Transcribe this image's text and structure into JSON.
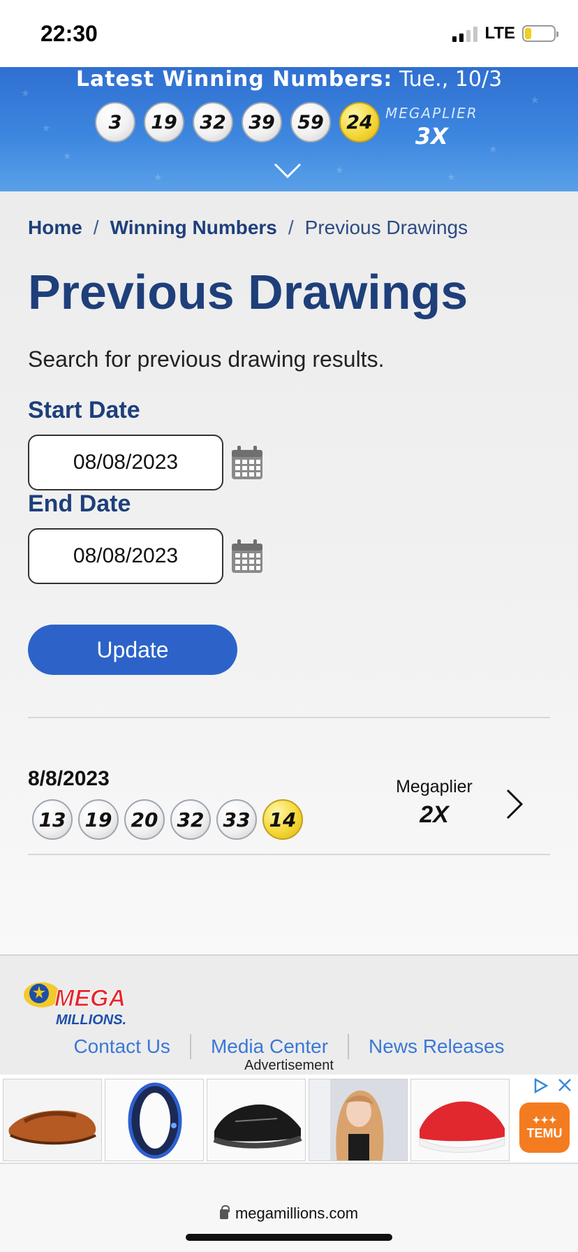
{
  "status_bar": {
    "time": "22:30",
    "network": "LTE"
  },
  "banner": {
    "title_bold": "Latest Winning Numbers:",
    "title_date": "Tue., 10/3",
    "numbers": [
      "3",
      "19",
      "32",
      "39",
      "59"
    ],
    "mega_ball": "24",
    "megaplier_label": "MEGAPLIER",
    "megaplier_value": "3X"
  },
  "breadcrumb": {
    "home": "Home",
    "separator": "/",
    "winning_numbers": "Winning Numbers",
    "current": "Previous Drawings"
  },
  "page": {
    "title": "Previous Drawings",
    "subtitle": "Search for previous drawing results."
  },
  "form": {
    "start_label": "Start Date",
    "start_value": "08/08/2023",
    "end_label": "End Date",
    "end_value": "08/08/2023",
    "update_label": "Update"
  },
  "results": [
    {
      "date": "8/8/2023",
      "numbers": [
        "13",
        "19",
        "20",
        "32",
        "33"
      ],
      "mega_ball": "14",
      "megaplier_label": "Megaplier",
      "megaplier_value": "2X"
    }
  ],
  "footer": {
    "links": [
      "Contact Us",
      "Media Center",
      "News Releases"
    ],
    "ad_label": "Advertisement",
    "ad_brand": "TEMU"
  },
  "browser": {
    "url": "megamillions.com"
  },
  "colors": {
    "brand_blue": "#1e3f7a",
    "button_blue": "#2d63c8",
    "mega_ball_yellow": "#f5d83a",
    "link_blue": "#3a78d6"
  }
}
